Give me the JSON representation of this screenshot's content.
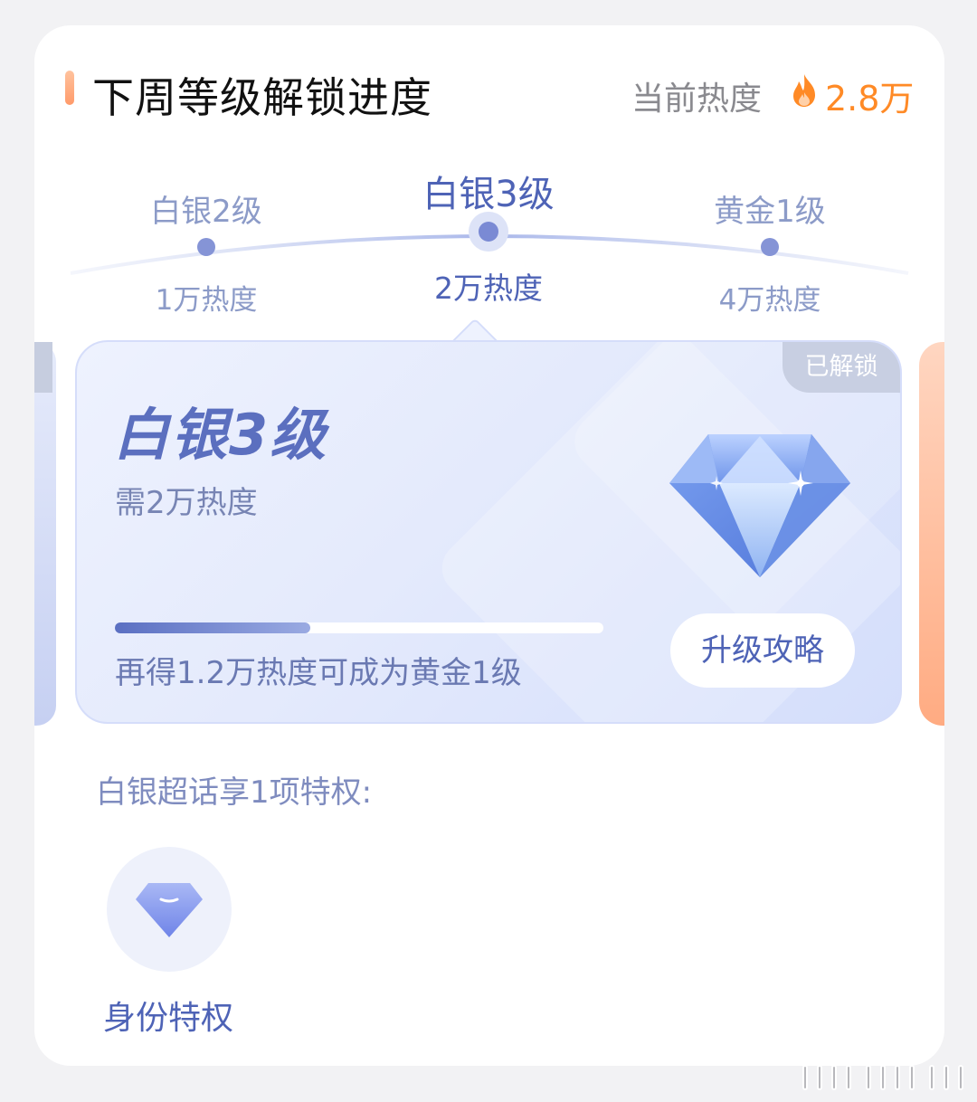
{
  "header": {
    "title": "下周等级解锁进度",
    "heat_label": "当前热度",
    "heat_value": "2.8万"
  },
  "levels": [
    {
      "name": "白银2级",
      "requirement": "1万热度"
    },
    {
      "name": "白银3级",
      "requirement": "2万热度"
    },
    {
      "name": "黄金1级",
      "requirement": "4万热度"
    }
  ],
  "card": {
    "badge": "已解锁",
    "title": "白银3级",
    "subtitle": "需2万热度",
    "progress_percent": 40,
    "note": "再得1.2万热度可成为黄金1级",
    "button": "升级攻略"
  },
  "privileges": {
    "title": "白银超话享1项特权:",
    "items": [
      {
        "label": "身份特权",
        "icon": "diamond-icon"
      }
    ]
  },
  "colors": {
    "accent_orange": "#ff8a26",
    "accent_blue": "#4e63b6"
  }
}
